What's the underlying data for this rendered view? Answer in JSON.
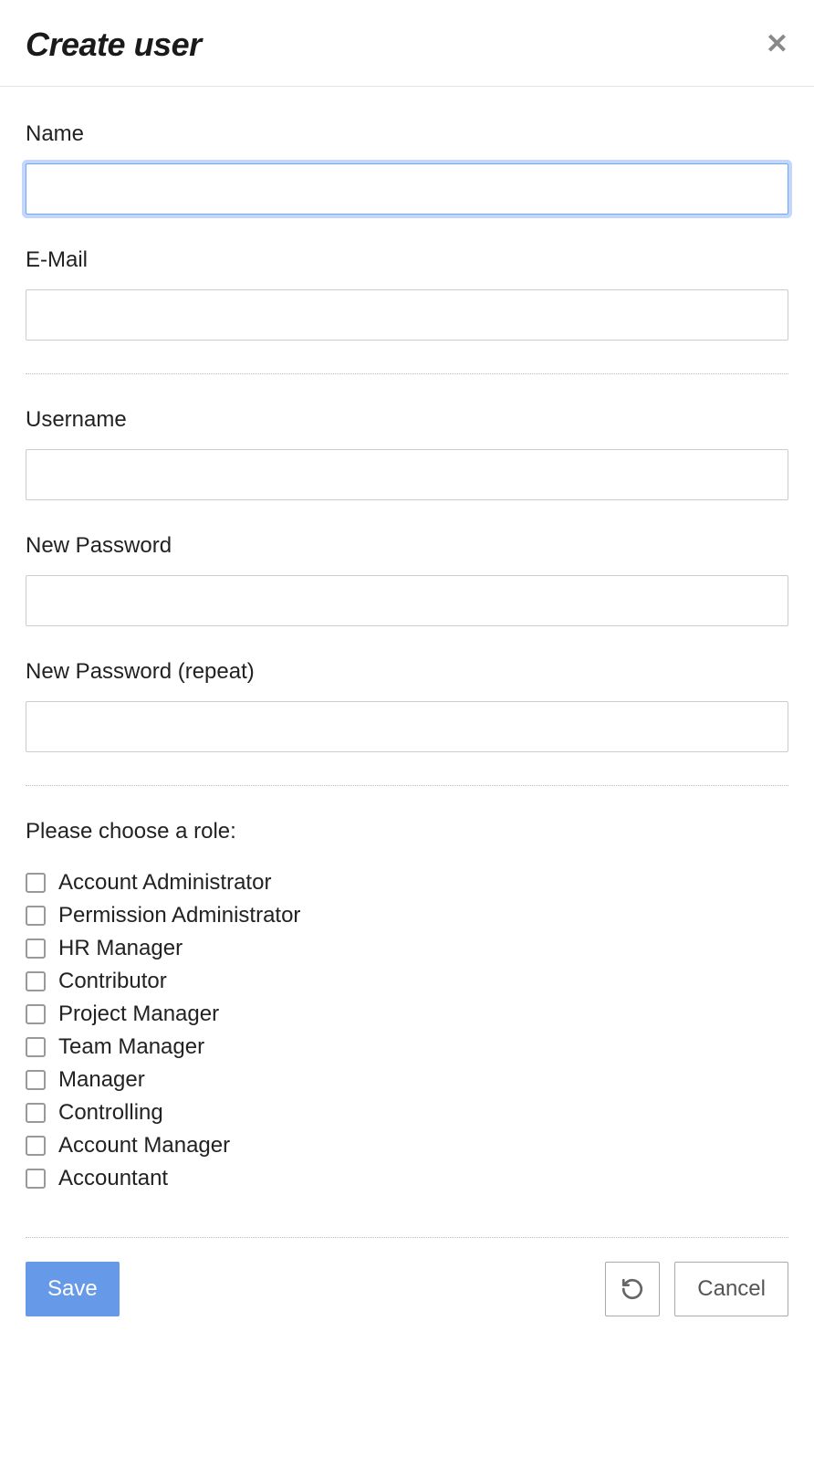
{
  "modal": {
    "title": "Create user"
  },
  "form": {
    "fields": {
      "name": {
        "label": "Name",
        "value": ""
      },
      "email": {
        "label": "E-Mail",
        "value": ""
      },
      "username": {
        "label": "Username",
        "value": ""
      },
      "password": {
        "label": "New Password",
        "value": ""
      },
      "password_repeat": {
        "label": "New Password (repeat)",
        "value": ""
      }
    },
    "roles": {
      "label": "Please choose a role:",
      "items": [
        {
          "label": "Account Administrator",
          "checked": false
        },
        {
          "label": "Permission Administrator",
          "checked": false
        },
        {
          "label": "HR Manager",
          "checked": false
        },
        {
          "label": "Contributor",
          "checked": false
        },
        {
          "label": "Project Manager",
          "checked": false
        },
        {
          "label": "Team Manager",
          "checked": false
        },
        {
          "label": "Manager",
          "checked": false
        },
        {
          "label": "Controlling",
          "checked": false
        },
        {
          "label": "Account Manager",
          "checked": false
        },
        {
          "label": "Accountant",
          "checked": false
        }
      ]
    }
  },
  "footer": {
    "save": "Save",
    "cancel": "Cancel"
  }
}
